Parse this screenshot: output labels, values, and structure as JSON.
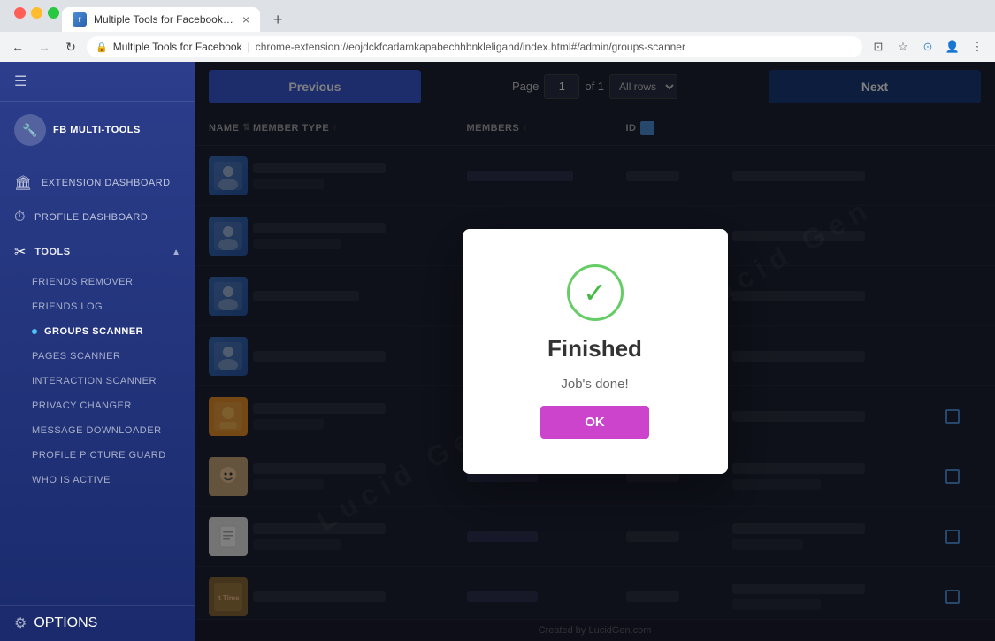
{
  "browser": {
    "tab_title": "Multiple Tools for Facebook b...",
    "site_name": "Multiple Tools for Facebook",
    "url": "chrome-extension://eojdckfcadamkapabechhbnkleligand/index.html#/admin/groups-scanner",
    "new_tab_label": "+"
  },
  "sidebar": {
    "brand_name": "FB MULTI-TOOLS",
    "nav_items": [
      {
        "id": "extension-dashboard",
        "label": "EXTENSION DASHBOARD",
        "icon": "🏛"
      },
      {
        "id": "profile-dashboard",
        "label": "PROFILE DASHBOARD",
        "icon": "⏱"
      }
    ],
    "tools_section": {
      "label": "TOOLS",
      "arrow": "▲"
    },
    "submenu_items": [
      {
        "id": "friends-remover",
        "label": "FRIENDS REMOVER",
        "active": false
      },
      {
        "id": "friends-log",
        "label": "FRIENDS LOG",
        "active": false
      },
      {
        "id": "groups-scanner",
        "label": "GROUPS SCANNER",
        "active": true
      },
      {
        "id": "pages-scanner",
        "label": "PAGES SCANNER",
        "active": false
      },
      {
        "id": "interaction-scanner",
        "label": "INTERACTION SCANNER",
        "active": false
      },
      {
        "id": "privacy-changer",
        "label": "PRIVACY CHANGER",
        "active": false
      },
      {
        "id": "message-downloader",
        "label": "MESSAGE DOWNLOADER",
        "active": false
      },
      {
        "id": "profile-picture-guard",
        "label": "PROFILE PICTURE GUARD",
        "active": false
      },
      {
        "id": "who-is-active",
        "label": "WHO IS ACTIVE",
        "active": false
      }
    ],
    "footer_item": {
      "label": "OPTIONS",
      "icon": "⚙"
    }
  },
  "toolbar": {
    "prev_label": "Previous",
    "next_label": "Next",
    "page_label": "Page",
    "page_number": "1",
    "of_label": "of 1",
    "rows_label": "All rows"
  },
  "table": {
    "headers": [
      {
        "id": "name",
        "label": "NAME",
        "sortable": true
      },
      {
        "id": "member-type",
        "label": "MEMBER TYPE",
        "sortable": true
      },
      {
        "id": "members",
        "label": "MEMBERS",
        "sortable": true
      },
      {
        "id": "id",
        "label": "ID",
        "sortable": false
      },
      {
        "id": "checkbox",
        "label": "",
        "sortable": false
      }
    ],
    "rows": [
      {
        "id": 1,
        "avatar_color": "blue",
        "has_checkbox": false
      },
      {
        "id": 2,
        "avatar_color": "blue",
        "has_checkbox": false
      },
      {
        "id": 3,
        "avatar_color": "blue",
        "has_checkbox": false
      },
      {
        "id": 4,
        "avatar_color": "blue",
        "has_checkbox": false
      },
      {
        "id": 5,
        "avatar_color": "orange",
        "has_checkbox": true
      },
      {
        "id": 6,
        "avatar_color": "teal",
        "has_checkbox": true
      },
      {
        "id": 7,
        "avatar_color": "document",
        "has_checkbox": true
      },
      {
        "id": 8,
        "avatar_color": "blue",
        "has_checkbox": true
      }
    ]
  },
  "modal": {
    "title": "Finished",
    "subtitle": "Job's done!",
    "ok_label": "OK"
  },
  "footer": {
    "text": "Created by LucidGen.com"
  },
  "watermark": "Lucid Gen"
}
